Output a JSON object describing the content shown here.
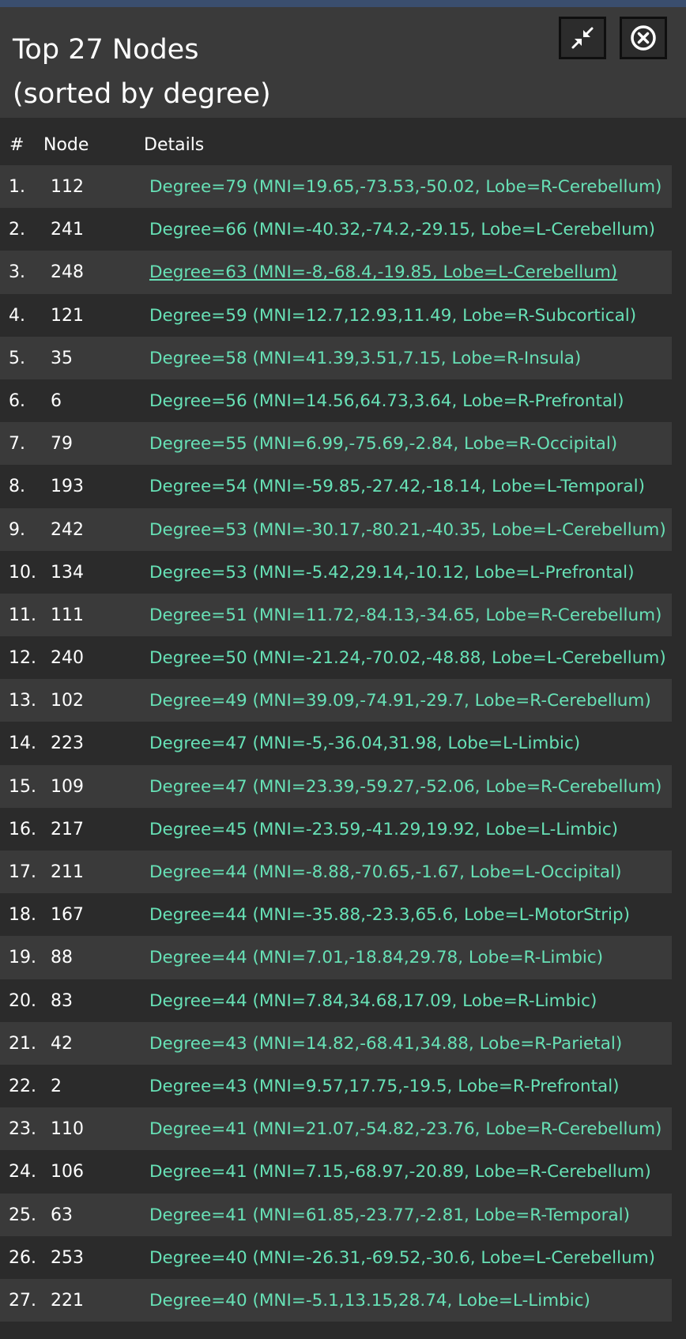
{
  "title_line1": "Top 27 Nodes",
  "title_line2": "(sorted by degree)",
  "buttons": {
    "minimize_icon": "compress-arrows-icon",
    "close_icon": "close-circle-icon"
  },
  "columns": {
    "num": "#",
    "node": "Node",
    "details": "Details"
  },
  "colors": {
    "details_text": "#67e1b6",
    "header_bg": "#3a3a3a",
    "row_alt": "#3a3a3a",
    "panel_bg": "#2b2b2b",
    "top_bar": "#3a4e6e"
  },
  "hovered_row": 3,
  "rows": [
    {
      "num": "1.",
      "node": "112",
      "details": "Degree=79 (MNI=19.65,-73.53,-50.02, Lobe=R-Cerebellum)"
    },
    {
      "num": "2.",
      "node": "241",
      "details": "Degree=66 (MNI=-40.32,-74.2,-29.15, Lobe=L-Cerebellum)"
    },
    {
      "num": "3.",
      "node": "248",
      "details": "Degree=63 (MNI=-8,-68.4,-19.85, Lobe=L-Cerebellum)"
    },
    {
      "num": "4.",
      "node": "121",
      "details": "Degree=59 (MNI=12.7,12.93,11.49, Lobe=R-Subcortical)"
    },
    {
      "num": "5.",
      "node": "35",
      "details": "Degree=58 (MNI=41.39,3.51,7.15, Lobe=R-Insula)"
    },
    {
      "num": "6.",
      "node": "6",
      "details": "Degree=56 (MNI=14.56,64.73,3.64, Lobe=R-Prefrontal)"
    },
    {
      "num": "7.",
      "node": "79",
      "details": "Degree=55 (MNI=6.99,-75.69,-2.84, Lobe=R-Occipital)"
    },
    {
      "num": "8.",
      "node": "193",
      "details": "Degree=54 (MNI=-59.85,-27.42,-18.14, Lobe=L-Temporal)"
    },
    {
      "num": "9.",
      "node": "242",
      "details": "Degree=53 (MNI=-30.17,-80.21,-40.35, Lobe=L-Cerebellum)"
    },
    {
      "num": "10.",
      "node": "134",
      "details": "Degree=53 (MNI=-5.42,29.14,-10.12, Lobe=L-Prefrontal)"
    },
    {
      "num": "11.",
      "node": "111",
      "details": "Degree=51 (MNI=11.72,-84.13,-34.65, Lobe=R-Cerebellum)"
    },
    {
      "num": "12.",
      "node": "240",
      "details": "Degree=50 (MNI=-21.24,-70.02,-48.88, Lobe=L-Cerebellum)"
    },
    {
      "num": "13.",
      "node": "102",
      "details": "Degree=49 (MNI=39.09,-74.91,-29.7, Lobe=R-Cerebellum)"
    },
    {
      "num": "14.",
      "node": "223",
      "details": "Degree=47 (MNI=-5,-36.04,31.98, Lobe=L-Limbic)"
    },
    {
      "num": "15.",
      "node": "109",
      "details": "Degree=47 (MNI=23.39,-59.27,-52.06, Lobe=R-Cerebellum)"
    },
    {
      "num": "16.",
      "node": "217",
      "details": "Degree=45 (MNI=-23.59,-41.29,19.92, Lobe=L-Limbic)"
    },
    {
      "num": "17.",
      "node": "211",
      "details": "Degree=44 (MNI=-8.88,-70.65,-1.67, Lobe=L-Occipital)"
    },
    {
      "num": "18.",
      "node": "167",
      "details": "Degree=44 (MNI=-35.88,-23.3,65.6, Lobe=L-MotorStrip)"
    },
    {
      "num": "19.",
      "node": "88",
      "details": "Degree=44 (MNI=7.01,-18.84,29.78, Lobe=R-Limbic)"
    },
    {
      "num": "20.",
      "node": "83",
      "details": "Degree=44 (MNI=7.84,34.68,17.09, Lobe=R-Limbic)"
    },
    {
      "num": "21.",
      "node": "42",
      "details": "Degree=43 (MNI=14.82,-68.41,34.88, Lobe=R-Parietal)"
    },
    {
      "num": "22.",
      "node": "2",
      "details": "Degree=43 (MNI=9.57,17.75,-19.5, Lobe=R-Prefrontal)"
    },
    {
      "num": "23.",
      "node": "110",
      "details": "Degree=41 (MNI=21.07,-54.82,-23.76, Lobe=R-Cerebellum)"
    },
    {
      "num": "24.",
      "node": "106",
      "details": "Degree=41 (MNI=7.15,-68.97,-20.89, Lobe=R-Cerebellum)"
    },
    {
      "num": "25.",
      "node": "63",
      "details": "Degree=41 (MNI=61.85,-23.77,-2.81, Lobe=R-Temporal)"
    },
    {
      "num": "26.",
      "node": "253",
      "details": "Degree=40 (MNI=-26.31,-69.52,-30.6, Lobe=L-Cerebellum)"
    },
    {
      "num": "27.",
      "node": "221",
      "details": "Degree=40 (MNI=-5.1,13.15,28.74, Lobe=L-Limbic)"
    }
  ]
}
